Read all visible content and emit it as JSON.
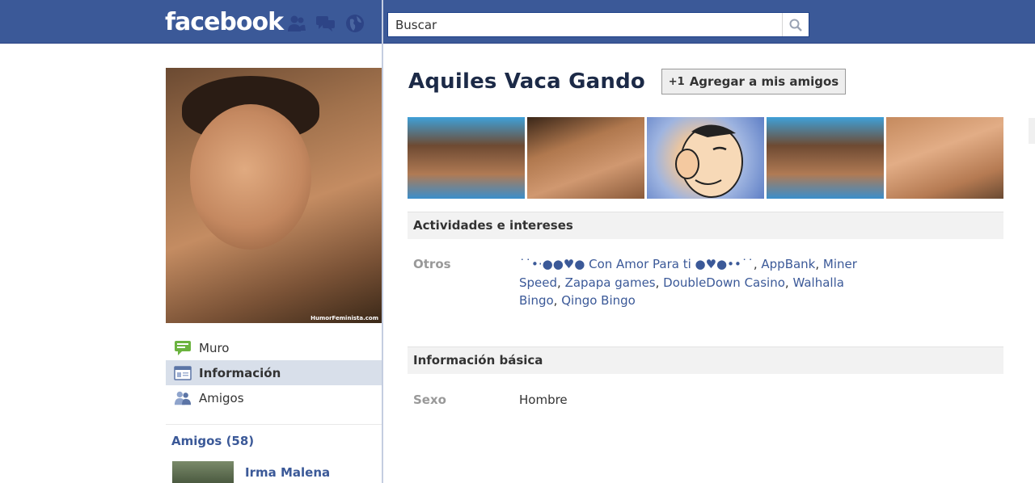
{
  "header": {
    "logo": "facebook",
    "search_placeholder": "Buscar",
    "jewels": [
      "friend-requests-icon",
      "messages-icon",
      "notifications-icon"
    ]
  },
  "profile": {
    "name": "Aquiles Vaca Gando",
    "add_friend_label": "Agregar a mis amigos",
    "photo_watermark": "HumorFeminista.com"
  },
  "sidebar": {
    "items": [
      {
        "label": "Muro",
        "icon": "wall-icon"
      },
      {
        "label": "Información",
        "icon": "info-icon"
      },
      {
        "label": "Amigos",
        "icon": "friends-icon"
      }
    ],
    "friends_title": "Amigos (58)",
    "friends": [
      {
        "name": "Irma Malena"
      }
    ]
  },
  "sections": {
    "activities": {
      "title": "Actividades e intereses",
      "label": "Otros",
      "items": [
        "˙˙•·●●♥● Con Amor Para ti ●♥●••˙˙",
        "AppBank",
        "Miner Speed",
        "Zapapa games",
        "DoubleDown Casino",
        "Walhalla Bingo",
        "Qingo Bingo"
      ]
    },
    "basic": {
      "title": "Información básica",
      "label": "Sexo",
      "value": "Hombre"
    }
  },
  "colors": {
    "brand_blue": "#3b5998",
    "active_nav": "#d8dfea",
    "section_header": "#f2f2f2"
  }
}
